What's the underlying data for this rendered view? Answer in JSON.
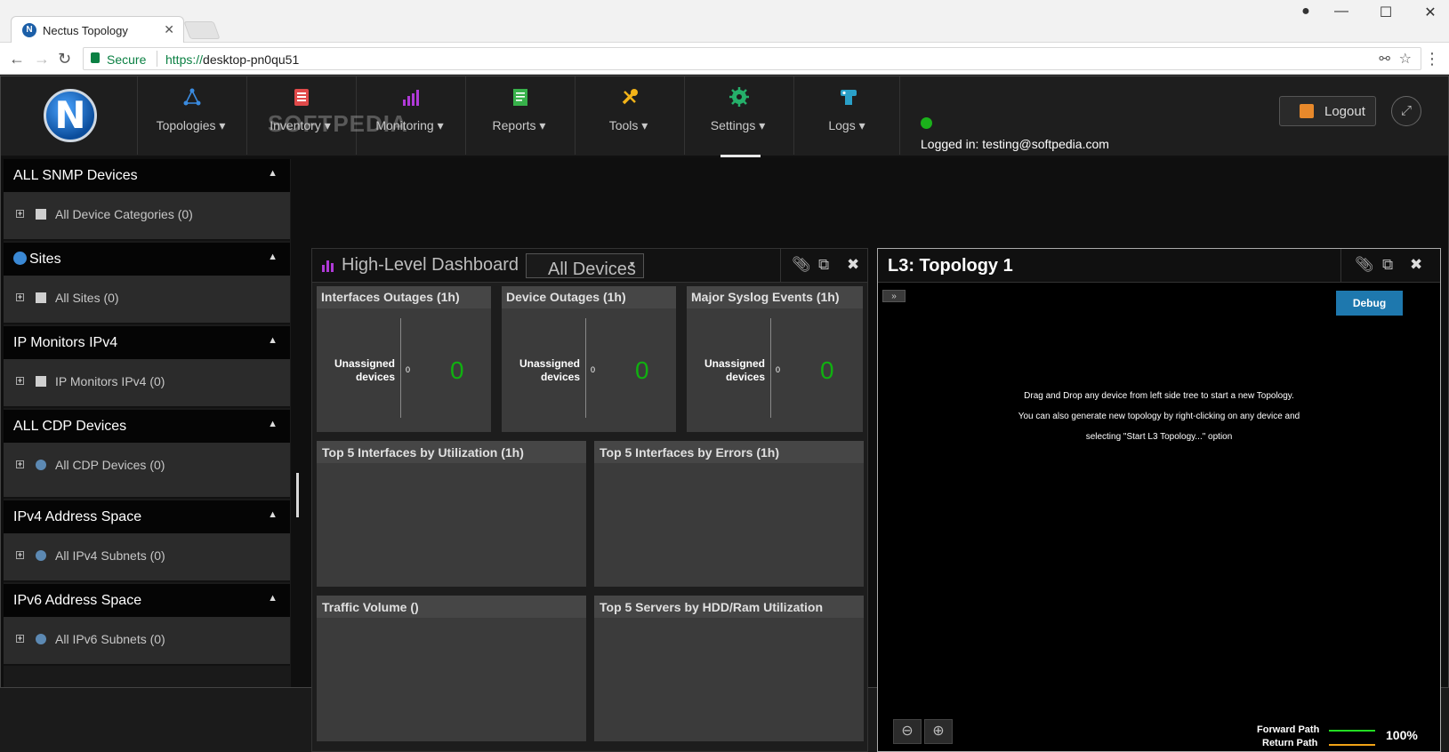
{
  "browser": {
    "tab_title": "Nectus Topology",
    "tab_close": "✕",
    "secure_label": "Secure",
    "url_scheme": "https://",
    "url_host": "desktop-pn0qu51"
  },
  "header": {
    "logo_letter": "N",
    "nav": [
      {
        "label": "Topologies",
        "icon": "topology-icon",
        "color": "#3a8be0"
      },
      {
        "label": "Inventory",
        "icon": "inventory-icon",
        "color": "#e04a4a"
      },
      {
        "label": "Monitoring",
        "icon": "monitoring-icon",
        "color": "#b03ad8"
      },
      {
        "label": "Reports",
        "icon": "reports-icon",
        "color": "#37b14a"
      },
      {
        "label": "Tools",
        "icon": "tools-icon",
        "color": "#f2b318"
      },
      {
        "label": "Settings",
        "icon": "settings-icon",
        "color": "#25b06a"
      },
      {
        "label": "Logs",
        "icon": "logs-icon",
        "color": "#2aa0c8"
      }
    ],
    "watermark": "SOFTPEDIA",
    "logged_in": "Logged in: testing@softpedia.com",
    "logout_label": "Logout"
  },
  "sidebar": {
    "sections": [
      {
        "title": "ALL SNMP Devices",
        "item": "All Device Categories (0)"
      },
      {
        "title": "Sites",
        "item": "All Sites (0)"
      },
      {
        "title": "IP Monitors IPv4",
        "item": "IP Monitors IPv4 (0)"
      },
      {
        "title": "ALL CDP Devices",
        "item": "All CDP Devices (0)"
      },
      {
        "title": "IPv4 Address Space",
        "item": "All IPv4 Subnets (0)"
      },
      {
        "title": "IPv6 Address Space",
        "item": "All IPv6 Subnets (0)"
      }
    ]
  },
  "dashboard": {
    "title": "High-Level Dashboard",
    "filter_value": "All Devices",
    "top_cards": [
      {
        "title": "Interfaces Outages (1h)",
        "label": "Unassigned devices",
        "small": "0",
        "value": "0"
      },
      {
        "title": "Device Outages (1h)",
        "label": "Unassigned devices",
        "small": "0",
        "value": "0"
      },
      {
        "title": "Major Syslog Events (1h)",
        "label": "Unassigned devices",
        "small": "0",
        "value": "0"
      }
    ],
    "mid_cards": [
      {
        "title": "Top 5 Interfaces by Utilization (1h)"
      },
      {
        "title": "Top 5 Interfaces by Errors (1h)"
      }
    ],
    "bottom_cards": [
      {
        "title": "Traffic Volume ()"
      },
      {
        "title": "Top 5 Servers by HDD/Ram Utilization"
      }
    ]
  },
  "topology": {
    "title": "L3: Topology 1",
    "toggle": "»",
    "debug_label": "Debug",
    "message_line1": "Drag and Drop any device from left side tree to start a new Topology.",
    "message_line2": "You can also generate new topology by right-clicking on any device and",
    "message_line3": "selecting  \"Start L3 Topology...\" option",
    "forward_label": "Forward Path",
    "return_label": "Return Path",
    "forward_color": "#22dd22",
    "return_color": "#f2a316",
    "zoom_level": "100%"
  }
}
